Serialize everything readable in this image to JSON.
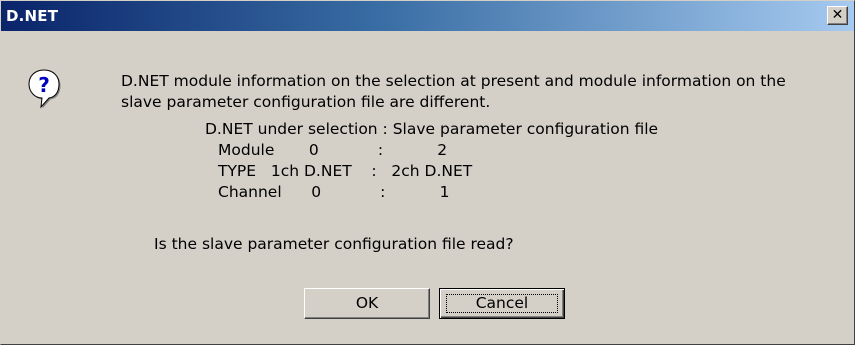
{
  "window": {
    "title": "D.NET"
  },
  "icons": {
    "question": "question-icon",
    "close": "close-icon"
  },
  "message": {
    "line1": "D.NET module information on the selection at present and module information on the",
    "line2": "slave parameter configuration file are different.",
    "line3": "D.NET under selection : Slave parameter configuration file",
    "line4": "Module       0            :           2",
    "line5": "TYPE   1ch D.NET    :   2ch D.NET",
    "line6": "Channel      0            :           1",
    "question": "Is the slave parameter configuration file read?"
  },
  "buttons": {
    "ok": "OK",
    "cancel": "Cancel"
  },
  "colors": {
    "title_start": "#0a246a",
    "title_end": "#a6caf0",
    "face": "#d4d0c8"
  }
}
